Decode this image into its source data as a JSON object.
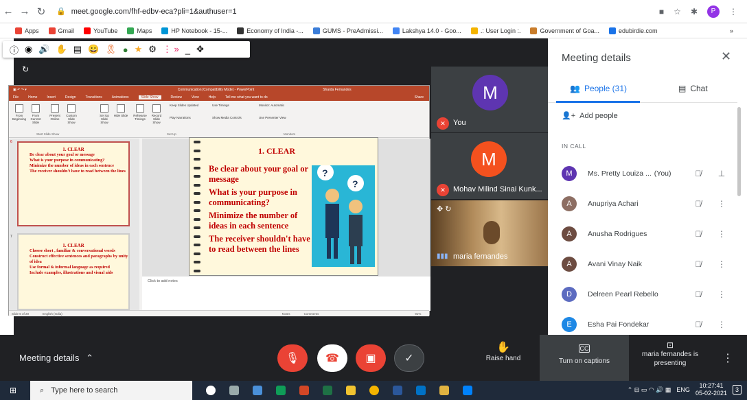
{
  "browser": {
    "url": "meet.google.com/fhf-edbv-eca?pli=1&authuser=1",
    "profile_initial": "P",
    "bookmarks": [
      "Apps",
      "Gmail",
      "YouTube",
      "Maps",
      "HP Notebook - 15-...",
      "Economy of India -...",
      "GUMS - PreAdmissi...",
      "Lakshya 14.0 - Goo...",
      ".: User Login :.",
      "Government of Goa...",
      "edubirdie.com"
    ],
    "more_bookmarks": "»"
  },
  "ppt": {
    "title": "Communication [Compatibility Mode] - PowerPoint",
    "user": "Sharda Fernandes",
    "share": "Share",
    "tabs": [
      "File",
      "Home",
      "Insert",
      "Design",
      "Transitions",
      "Animations",
      "Slide Show",
      "Review",
      "View",
      "Help",
      "Tell me what you want to do"
    ],
    "active_tab": "Slide Show",
    "ribbon_buttons": [
      "From Beginning",
      "From Current Slide",
      "Present Online",
      "Custom Slide Show",
      "Set Up Slide Show",
      "Hide Slide",
      "Rehearse Timings",
      "Record Slide Show"
    ],
    "ribbon_options": [
      "Keep Slides Updated",
      "Use Timings",
      "Play Narrations",
      "Show Media Controls",
      "Monitor: Automatic",
      "Use Presenter View"
    ],
    "group_labels": [
      "Start Slide Show",
      "Set Up",
      "Monitors"
    ],
    "slide6_num": "6",
    "slide7_num": "7",
    "slide_title": "1. CLEAR",
    "points": [
      "Be clear about your goal or message",
      "What is your purpose in communicating?",
      "Minimize the number of ideas in each sentence",
      "The receiver shouldn't have to read between the lines"
    ],
    "slide7_points": [
      "Choose short , familiar & conversational words",
      "Construct effective sentences and paragraphs by unity of idea",
      "Use formal & informal language as required",
      "Include examples, illustrations and visual aids"
    ],
    "notes_placeholder": "Click to add notes",
    "status": "Slide 6 of 20",
    "language": "English (India)",
    "status_notes": "Notes",
    "status_comments": "Comments",
    "zoom": "91%"
  },
  "tiles": [
    {
      "initial": "M",
      "name": "You",
      "color": "#5e35b1"
    },
    {
      "initial": "M",
      "name": "Mohav Milind Sinai Kunk...",
      "color": "#f4511e"
    },
    {
      "name": "maria fernandes"
    }
  ],
  "panel": {
    "title": "Meeting details",
    "people_tab": "People (31)",
    "chat_tab": "Chat",
    "add_people": "Add people",
    "in_call": "IN CALL",
    "participants": [
      {
        "initial": "M",
        "name": "Ms. Pretty Louiza ...",
        "suffix": "(You)",
        "color": "#5e35b1"
      },
      {
        "initial": "A",
        "name": "Anupriya Achari",
        "color": "#8d6e63"
      },
      {
        "initial": "A",
        "name": "Anusha Rodrigues",
        "color": "#6d4c41"
      },
      {
        "initial": "A",
        "name": "Avani Vinay Naik",
        "color": "#6d4c41"
      },
      {
        "initial": "D",
        "name": "Delreen Pearl Rebello",
        "color": "#5c6bc0"
      },
      {
        "initial": "E",
        "name": "Esha Pai Fondekar",
        "color": "#1e88e5"
      }
    ]
  },
  "bottom": {
    "meeting_details": "Meeting details",
    "raise_hand": "Raise hand",
    "captions": "Turn on captions",
    "presenting": "maria fernandes is presenting"
  },
  "taskbar": {
    "search_placeholder": "Type here to search",
    "lang": "ENG",
    "time": "10:27:41",
    "date": "05-02-2021",
    "notifications": "3"
  }
}
